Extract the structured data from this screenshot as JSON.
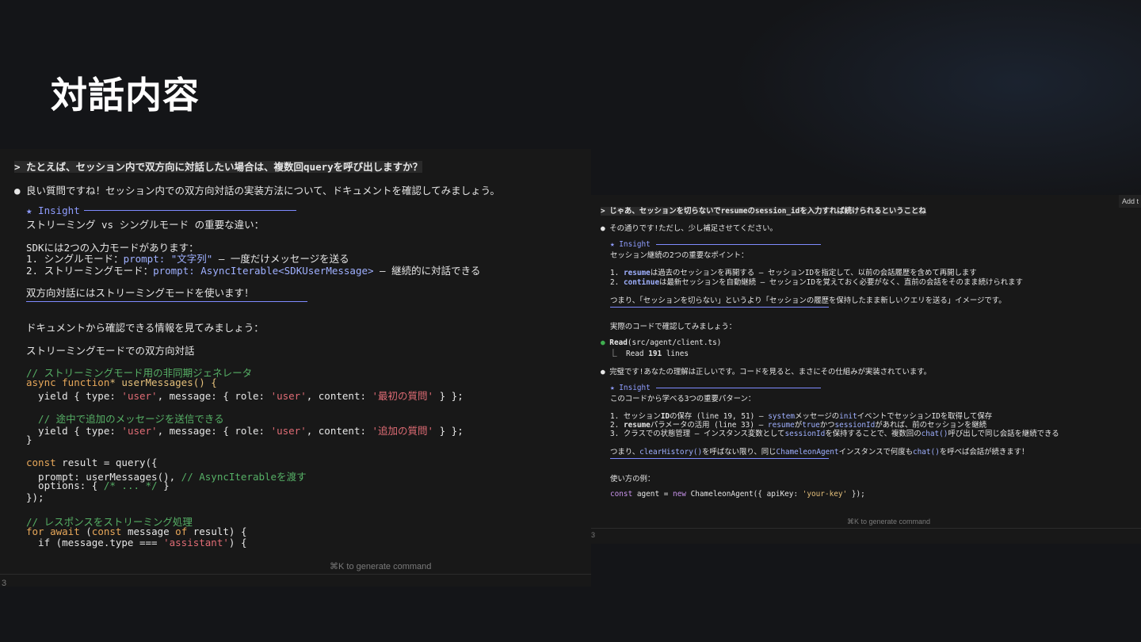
{
  "slide": {
    "title": "対話内容"
  },
  "left": {
    "question": "> たとえば、セッション内で双方向に対話したい場合は、複数回queryを呼び出しますか？",
    "answer": "● 良い質問ですね！セッション内での双方向対話の実装方法について、ドキュメントを確認してみましょう。",
    "insight_label": "★ Insight",
    "insight_heading": "ストリーミング vs シングルモード の重要な違い：",
    "sdk_line": "SDKには2つの入力モードがあります：",
    "mode1_prefix": "1. シングルモード：",
    "mode1_code": "prompt: \"文字列\"",
    "mode1_suffix": " – 一度だけメッセージを送る",
    "mode2_prefix": "2. ストリーミングモード：",
    "mode2_code": "prompt: AsyncIterable<SDKUserMessage>",
    "mode2_suffix": " – 継続的に対話できる",
    "bidi_note": "双方向対話にはストリーミングモードを使います！",
    "docs_line": "ドキュメントから確認できる情報を見てみましょう：",
    "stream_heading": "ストリーミングモードでの双方向対話",
    "code": {
      "c1": "// ストリーミングモード用の非同期ジェネレータ",
      "l2a": "async function",
      "l2b": "* userMessages() {",
      "l3a": "  yield { type: ",
      "l3b": "'user'",
      "l3c": ", message: { role: ",
      "l3d": "'user'",
      "l3e": ", content: ",
      "l3f": "'最初の質問'",
      "l3g": " } };",
      "c2": "  // 途中で追加のメッセージを送信できる",
      "l5a": "  yield { type: ",
      "l5b": "'user'",
      "l5c": ", message: { role: ",
      "l5d": "'user'",
      "l5e": ", content: ",
      "l5f": "'追加の質問'",
      "l5g": " } };",
      "l6": "}",
      "l7a": "const",
      "l7b": " result = query({",
      "l8a": "  prompt: userMessages(), ",
      "l8b": "// AsyncIterableを渡す",
      "l9a": "  options: { ",
      "l9b": "/* ... */",
      "l9c": " }",
      "l10": "});",
      "c3": "// レスポンスをストリーミング処理",
      "l12a": "for await",
      "l12b": " (",
      "l12c": "const",
      "l12d": " message ",
      "l12e": "of",
      "l12f": " result) {",
      "l13a": "  if (message.type === ",
      "l13b": "'assistant'",
      "l13c": ") {"
    },
    "hint": "⌘K to generate command",
    "line_number": "3"
  },
  "right": {
    "question": "> じゃあ、セッションを切らないでresumeのsession_idを入力すれば続けられるということね",
    "answer1": "● その通りです!ただし、少し補足させてください。",
    "insight1_label": "★ Insight",
    "insight1_heading": "セッション継続の2つの重要なポイント：",
    "p1_num": "1. ",
    "p1_kw": "resume",
    "p1_text": "は過去のセッションを再開する – セッションIDを指定して、以前の会話履歴を含めて再開します",
    "p2_num": "2. ",
    "p2_kw": "continue",
    "p2_text": "は最新セッションを自動継続 – セッションIDを覚えておく必要がなく、直前の会話をそのまま続けられます",
    "summary1": "つまり、「セッションを切らない」というより「セッションの履歴を保持したまま新しいクエリを送る」イメージです。",
    "check_line": "実際のコードで確認してみましょう：",
    "read_tool": "Read",
    "read_arg": "(src/agent/client.ts)",
    "read_result_a": "  ⎿  Read ",
    "read_result_b": "191",
    "read_result_c": " lines",
    "answer2": "● 完璧です!あなたの理解は正しいです。コードを見ると、まさにその仕組みが実装されています。",
    "insight2_label": "★ Insight",
    "insight2_heading": "このコードから学べる3つの重要パターン：",
    "q1a": "1. セッション",
    "q1b": "ID",
    "q1c": "の保存 (line 19, 51) – ",
    "q1d": "system",
    "q1e": "メッセージの",
    "q1f": "init",
    "q1g": "イベントでセッションIDを取得して保存",
    "q2a": "2. ",
    "q2b": "resume",
    "q2c": "パラメータの活用 (line 33) – ",
    "q2d": "resume",
    "q2e": "が",
    "q2f": "true",
    "q2g": "かつ",
    "q2h": "sessionId",
    "q2i": "があれば、前のセッションを継続",
    "q3a": "3. クラスでの状態管理 – インスタンス変数として",
    "q3b": "sessionId",
    "q3c": "を保持することで、複数回の",
    "q3d": "chat()",
    "q3e": "呼び出しで同じ会話を継続できる",
    "s2a": "つまり、",
    "s2b": "clearHistory()",
    "s2c": "を呼ばない限り、同じ",
    "s2d": "ChameleonAgent",
    "s2e": "インスタンスで何度も",
    "s2f": "chat()",
    "s2g": "を呼べば会話が続きます！",
    "usage": "使い方の例：",
    "u1": "const",
    "u2": " agent = ",
    "u3": "new",
    "u4": " ChameleonAgent({ apiKey: ",
    "u5": "'your-key'",
    "u6": " });",
    "hint": "⌘K to generate command",
    "line_number": "3",
    "add_button": "Add t"
  }
}
